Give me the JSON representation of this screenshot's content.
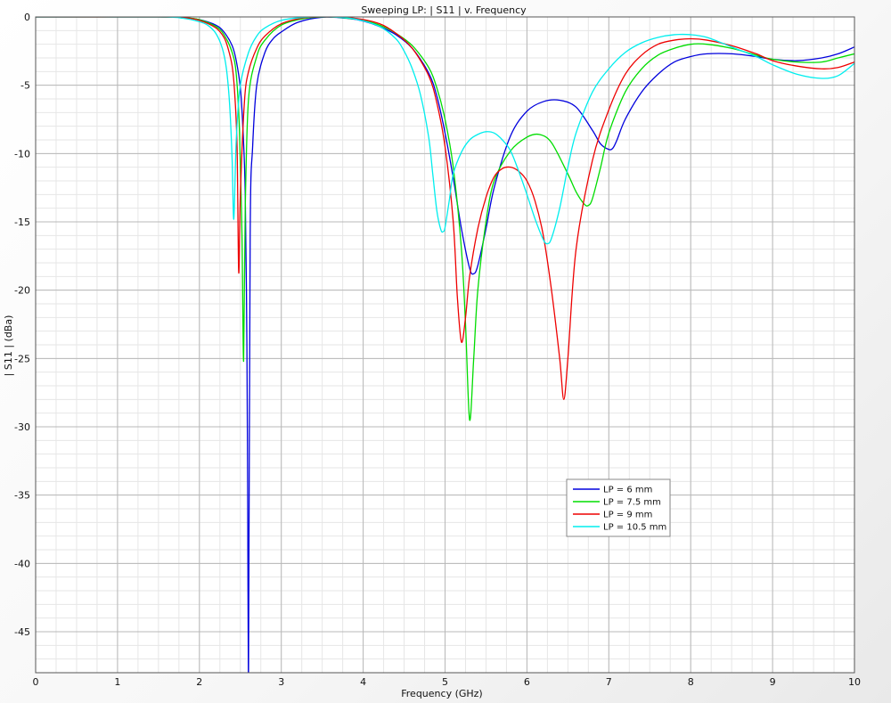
{
  "chart_data": {
    "type": "line",
    "title": "Sweeping LP: | S11 | v. Frequency",
    "xlabel": "Frequency (GHz)",
    "ylabel": "| S11 | (dBa)",
    "xlim": [
      0,
      10
    ],
    "ylim": [
      -48,
      0
    ],
    "xticks": [
      0,
      1,
      2,
      3,
      4,
      5,
      6,
      7,
      8,
      9,
      10
    ],
    "yticks": [
      0,
      -5,
      -10,
      -15,
      -20,
      -25,
      -30,
      -35,
      -40,
      -45
    ],
    "grid": true,
    "legend_position": "center-right",
    "series": [
      {
        "name": "LP = 6 mm",
        "color": "#0000dd",
        "x": [
          0,
          1.5,
          1.8,
          2.0,
          2.2,
          2.3,
          2.4,
          2.45,
          2.5,
          2.53,
          2.56,
          2.58,
          2.59,
          2.6,
          2.62,
          2.65,
          2.7,
          2.8,
          2.9,
          3.0,
          3.2,
          3.5,
          3.8,
          4.0,
          4.2,
          4.4,
          4.6,
          4.8,
          4.9,
          5.0,
          5.1,
          5.2,
          5.3,
          5.35,
          5.4,
          5.5,
          5.6,
          5.8,
          6.0,
          6.2,
          6.4,
          6.6,
          6.8,
          6.9,
          7.0,
          7.05,
          7.1,
          7.2,
          7.4,
          7.6,
          7.8,
          8.0,
          8.2,
          8.5,
          8.8,
          9.0,
          9.3,
          9.6,
          9.8,
          10.0
        ],
        "y": [
          0,
          0,
          -0.05,
          -0.2,
          -0.6,
          -1.1,
          -2.1,
          -3.2,
          -5.2,
          -8.0,
          -13.0,
          -24.0,
          -36.0,
          -47.9,
          -16.0,
          -9.5,
          -5.0,
          -2.6,
          -1.6,
          -1.1,
          -0.4,
          -0.02,
          -0.1,
          -0.3,
          -0.7,
          -1.3,
          -2.3,
          -4.1,
          -5.8,
          -8.5,
          -11.8,
          -15.5,
          -18.4,
          -18.8,
          -18.2,
          -15.5,
          -12.5,
          -8.7,
          -6.9,
          -6.2,
          -6.1,
          -6.6,
          -8.3,
          -9.3,
          -9.7,
          -9.6,
          -9.0,
          -7.5,
          -5.5,
          -4.2,
          -3.3,
          -2.9,
          -2.7,
          -2.7,
          -2.9,
          -3.1,
          -3.2,
          -3.0,
          -2.7,
          -2.2
        ]
      },
      {
        "name": "LP = 7.5 mm",
        "color": "#00dd00",
        "x": [
          0,
          1.5,
          1.8,
          2.0,
          2.2,
          2.3,
          2.4,
          2.45,
          2.49,
          2.52,
          2.54,
          2.56,
          2.6,
          2.7,
          2.8,
          3.0,
          3.3,
          3.6,
          3.9,
          4.0,
          4.2,
          4.4,
          4.6,
          4.8,
          4.9,
          5.0,
          5.1,
          5.2,
          5.25,
          5.3,
          5.35,
          5.4,
          5.5,
          5.6,
          5.8,
          6.0,
          6.15,
          6.3,
          6.5,
          6.6,
          6.7,
          6.75,
          6.8,
          6.9,
          7.0,
          7.2,
          7.4,
          7.6,
          7.8,
          8.0,
          8.2,
          8.5,
          8.8,
          9.0,
          9.3,
          9.6,
          9.8,
          10.0
        ],
        "y": [
          0,
          0,
          -0.05,
          -0.2,
          -0.7,
          -1.3,
          -2.6,
          -4.2,
          -8.5,
          -16.0,
          -25.2,
          -14.0,
          -6.0,
          -2.9,
          -1.7,
          -0.6,
          -0.1,
          0,
          -0.15,
          -0.25,
          -0.6,
          -1.2,
          -2.1,
          -3.7,
          -5.2,
          -7.5,
          -11.0,
          -17.0,
          -22.5,
          -29.5,
          -25.0,
          -20.0,
          -15.0,
          -12.0,
          -9.8,
          -8.8,
          -8.6,
          -9.2,
          -11.5,
          -12.8,
          -13.7,
          -13.8,
          -13.3,
          -11.0,
          -8.5,
          -5.5,
          -3.8,
          -2.8,
          -2.3,
          -2.0,
          -2.0,
          -2.3,
          -2.8,
          -3.1,
          -3.3,
          -3.3,
          -3.0,
          -2.7
        ]
      },
      {
        "name": "LP = 9 mm",
        "color": "#ee0000",
        "x": [
          0,
          1.5,
          1.8,
          2.0,
          2.2,
          2.3,
          2.35,
          2.4,
          2.43,
          2.46,
          2.48,
          2.5,
          2.55,
          2.6,
          2.7,
          2.8,
          3.0,
          3.3,
          3.6,
          3.9,
          4.2,
          4.4,
          4.6,
          4.8,
          4.9,
          5.0,
          5.1,
          5.15,
          5.2,
          5.25,
          5.3,
          5.4,
          5.5,
          5.6,
          5.7,
          5.8,
          5.9,
          6.0,
          6.1,
          6.2,
          6.3,
          6.4,
          6.45,
          6.5,
          6.6,
          6.8,
          7.0,
          7.2,
          7.4,
          7.6,
          7.8,
          8.0,
          8.2,
          8.5,
          8.8,
          9.0,
          9.3,
          9.6,
          9.8,
          10.0
        ],
        "y": [
          0,
          0,
          -0.05,
          -0.25,
          -0.8,
          -1.5,
          -2.3,
          -3.6,
          -5.5,
          -9.5,
          -18.7,
          -13.0,
          -6.2,
          -4.0,
          -2.3,
          -1.4,
          -0.5,
          -0.05,
          0,
          -0.1,
          -0.5,
          -1.2,
          -2.3,
          -4.3,
          -6.3,
          -9.5,
          -15.0,
          -20.5,
          -23.8,
          -22.0,
          -19.0,
          -15.5,
          -13.2,
          -11.7,
          -11.1,
          -11.0,
          -11.3,
          -12.0,
          -13.5,
          -16.0,
          -20.0,
          -25.0,
          -28.0,
          -25.0,
          -17.0,
          -10.5,
          -6.8,
          -4.2,
          -2.8,
          -2.0,
          -1.7,
          -1.6,
          -1.7,
          -2.1,
          -2.7,
          -3.2,
          -3.6,
          -3.8,
          -3.7,
          -3.3
        ]
      },
      {
        "name": "LP = 10.5 mm",
        "color": "#00eeee",
        "x": [
          0,
          1.5,
          1.8,
          2.0,
          2.1,
          2.2,
          2.28,
          2.33,
          2.37,
          2.4,
          2.42,
          2.45,
          2.5,
          2.6,
          2.7,
          2.8,
          3.0,
          3.3,
          3.6,
          3.9,
          4.2,
          4.4,
          4.5,
          4.6,
          4.7,
          4.8,
          4.85,
          4.9,
          4.95,
          4.98,
          5.0,
          5.05,
          5.1,
          5.2,
          5.3,
          5.4,
          5.5,
          5.6,
          5.7,
          5.8,
          5.9,
          6.0,
          6.1,
          6.2,
          6.25,
          6.3,
          6.4,
          6.5,
          6.6,
          6.8,
          7.0,
          7.2,
          7.4,
          7.6,
          7.8,
          8.0,
          8.2,
          8.5,
          8.8,
          9.0,
          9.3,
          9.6,
          9.8,
          10.0
        ],
        "y": [
          0,
          0,
          -0.1,
          -0.35,
          -0.6,
          -1.2,
          -2.3,
          -3.8,
          -6.5,
          -10.5,
          -14.8,
          -9.0,
          -5.0,
          -2.6,
          -1.4,
          -0.8,
          -0.25,
          -0.02,
          0,
          -0.15,
          -0.7,
          -1.6,
          -2.5,
          -3.8,
          -5.7,
          -8.8,
          -11.5,
          -14.2,
          -15.6,
          -15.7,
          -15.4,
          -13.5,
          -11.5,
          -9.9,
          -9.0,
          -8.6,
          -8.4,
          -8.5,
          -9.0,
          -9.8,
          -11.3,
          -13.0,
          -14.8,
          -16.3,
          -16.6,
          -16.2,
          -14.0,
          -11.0,
          -8.5,
          -5.5,
          -3.8,
          -2.6,
          -1.9,
          -1.5,
          -1.3,
          -1.3,
          -1.5,
          -2.2,
          -2.9,
          -3.5,
          -4.2,
          -4.5,
          -4.3,
          -3.4
        ]
      }
    ]
  }
}
